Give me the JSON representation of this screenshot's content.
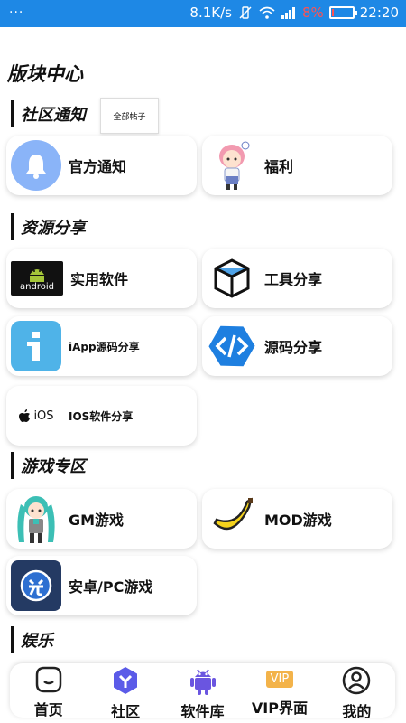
{
  "status_bar": {
    "dots": "···",
    "speed": "8.1K/s",
    "battery_percent": "8%",
    "battery_level": 0.08,
    "time": "22:20"
  },
  "page": {
    "title": "版块中心"
  },
  "sections": {
    "community": {
      "title": "社区通知",
      "all_posts": "全部帖子"
    },
    "resources": {
      "title": "资源分享"
    },
    "games": {
      "title": "游戏专区"
    },
    "entertainment": {
      "title": "娱乐"
    }
  },
  "cards": {
    "official": "官方通知",
    "welfare": "福利",
    "practical_software": "实用软件",
    "tool_share": "工具分享",
    "iapp_source": "iApp源码分享",
    "source_share": "源码分享",
    "ios_software": "IOS软件分享",
    "gm_games": "GM游戏",
    "mod_games": "MOD游戏",
    "android_pc_games": "安卓/PC游戏"
  },
  "icon_text": {
    "android": "android",
    "ios": "iOS",
    "vip": "VIP"
  },
  "nav": {
    "home": "首页",
    "community": "社区",
    "software": "软件库",
    "vip": "VIP界面",
    "mine": "我的"
  },
  "colors": {
    "status_bar": "#1e88e5",
    "bell_bg": "#8ab4f8",
    "iapp_bg": "#4fb3e8",
    "source_blue": "#1e7fe0",
    "nav_purple": "#5b5be8",
    "vip_gold": "#f3b34a"
  }
}
